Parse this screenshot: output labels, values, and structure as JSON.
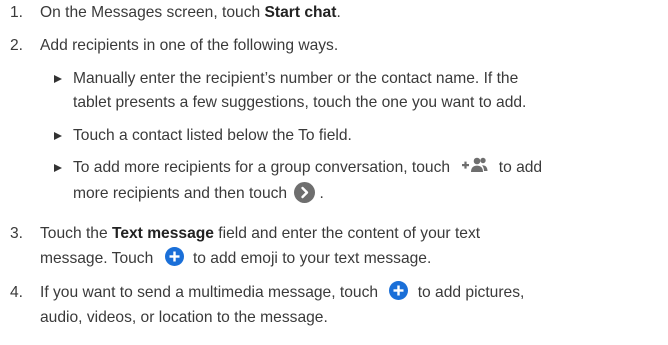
{
  "steps": [
    {
      "num": "1.",
      "pre": "On the Messages screen, touch ",
      "bold": "Start chat",
      "post": "."
    },
    {
      "num": "2.",
      "text": "Add recipients in one of the following ways."
    },
    {
      "num": "3.",
      "pre": "Touch the ",
      "bold": "Text message",
      "post_line1": " field and enter the content of your text",
      "line2_pre": "message.  Touch ",
      "line2_post": " to add emoji to your text message."
    },
    {
      "num": "4.",
      "line1_pre": "If you want to send a multimedia message, touch ",
      "line1_post": " to add pictures,",
      "line2": "audio, videos, or location to the message."
    }
  ],
  "sub_items": [
    {
      "line1": "Manually enter the recipient’s number or the contact name. If the",
      "line2": "tablet presents a few suggestions, touch the one you want to add."
    },
    {
      "line1": "Touch a contact listed below the To field."
    },
    {
      "line1_pre": "To add more recipients for a group conversation, touch ",
      "line1_post": " to add",
      "line2_pre": "more recipients and then touch ",
      "line2_post": "."
    }
  ],
  "icons": {
    "group_add": "add-group-icon",
    "next": "chevron-right-icon",
    "add": "plus-circle-icon"
  },
  "colors": {
    "plus_icon": "#1a6fd8",
    "next_icon": "#6e6e6e",
    "text": "#3a3a3a"
  }
}
